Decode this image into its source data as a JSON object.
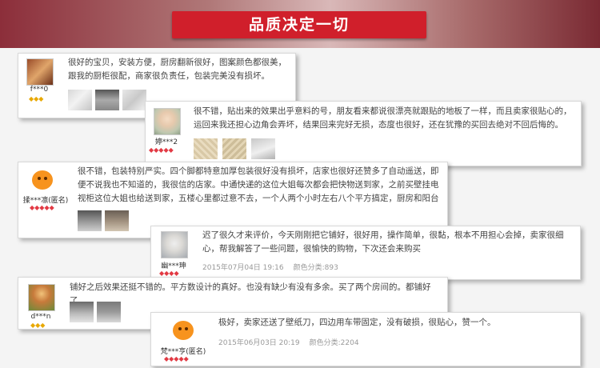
{
  "banner": {
    "title": "品质决定一切"
  },
  "colors": {
    "banner": "#d01f2b",
    "star_gold": "#e8a800",
    "star_red": "#e23a44"
  },
  "reviews": [
    {
      "user": "f***0",
      "avatar": "photo-avatar",
      "badge": "◆◆◆",
      "badge_color": "gold",
      "text": "很好的宝贝，安装方便，厨房翻新很好，图案颜色都很美，跟我的厨柜很配，商家很负责任，包装完美没有损坏。"
    },
    {
      "user": "婷***2",
      "avatar": "photo-avatar",
      "badge": "◆◆◆◆◆",
      "badge_color": "red",
      "text": "很不错，贴出来的效果出乎意料的号，朋友看来都说很漂亮就跟贴的地板了一样，而且卖家很贴心的，运回来我还担心边角会弄坏，结果回来完好无损，态度也很好，还在犹豫的买回去绝对不回后悔的。"
    },
    {
      "user": "揉***凛(匿名)",
      "avatar": "taobao-default-avatar",
      "badge": "◆◆◆◆◆",
      "badge_color": "red",
      "text": "很不错，包装特别严实。四个脚都特意加厚包装很好没有损坏，店家也很好还赞多了自动遥送，即便不说我也不知道的，我很信的店家。中通快递的这位大姐每次都会把快物送到家，之前买壁挂电视柜这位大姐也给送到家，五楼心里都过意不去，一个人两个小时左右八个平方搞定，厨房和阳台"
    },
    {
      "user": "幽***珅",
      "avatar": "photo-avatar",
      "badge": "◆◆◆◆",
      "badge_color": "red",
      "text": "迟了很久才来评价，今天刚刚把它铺好，很好用，操作简单，很黏，根本不用担心会掉，卖家很细心，帮我解答了一些问题，很愉快的购物，下次还会来购买",
      "date": "2015年07月04日 19:16",
      "spec": "颜色分类:893"
    },
    {
      "user": "d***n",
      "avatar": "photo-avatar",
      "badge": "◆◆◆",
      "badge_color": "gold",
      "text": "铺好之后效果还挺不错的。平方数设计的真好。也没有缺少有没有多余。买了两个房间的。都铺好了。"
    },
    {
      "user": "梵***亨(匿名)",
      "avatar": "taobao-default-avatar",
      "badge": "◆◆◆◆◆",
      "badge_color": "red",
      "text": "极好，卖家还送了壁纸刀，四边用车带固定，没有破损，很贴心，赞一个。",
      "date": "2015年06月03日 20:19",
      "spec": "颜色分类:2204"
    }
  ]
}
